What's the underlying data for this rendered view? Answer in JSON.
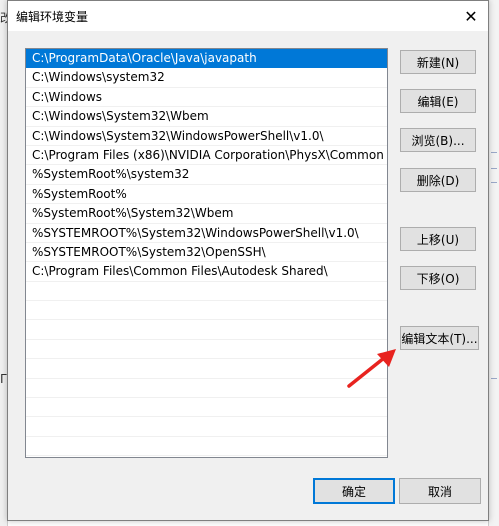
{
  "background": {
    "left_fragments": [
      "改",
      "月"
    ],
    "left_line_label": "Γ"
  },
  "dialog": {
    "title": "编辑环境变量",
    "close_glyph": "✕"
  },
  "paths": [
    "C:\\ProgramData\\Oracle\\Java\\javapath",
    "C:\\Windows\\system32",
    "C:\\Windows",
    "C:\\Windows\\System32\\Wbem",
    "C:\\Windows\\System32\\WindowsPowerShell\\v1.0\\",
    "C:\\Program Files (x86)\\NVIDIA Corporation\\PhysX\\Common",
    "%SystemRoot%\\system32",
    "%SystemRoot%",
    "%SystemRoot%\\System32\\Wbem",
    "%SYSTEMROOT%\\System32\\WindowsPowerShell\\v1.0\\",
    "%SYSTEMROOT%\\System32\\OpenSSH\\",
    "C:\\Program Files\\Common Files\\Autodesk Shared\\"
  ],
  "selected_index": 0,
  "buttons": {
    "new": "新建(N)",
    "edit": "编辑(E)",
    "browse": "浏览(B)...",
    "delete": "删除(D)",
    "move_up": "上移(U)",
    "move_down": "下移(O)",
    "edit_text": "编辑文本(T)...",
    "ok": "确定",
    "cancel": "取消"
  },
  "colors": {
    "selection": "#0078d7",
    "annotation_arrow": "#e8231f"
  },
  "icons": {
    "close": "close-icon",
    "annotation": "red-arrow-icon"
  }
}
